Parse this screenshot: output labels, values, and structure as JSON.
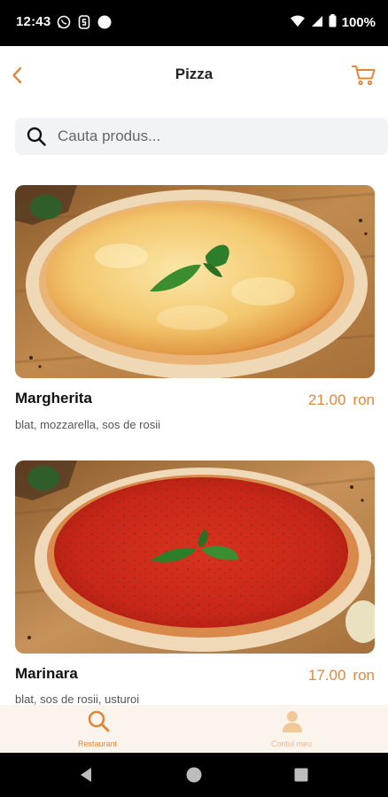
{
  "status_bar": {
    "time": "12:43",
    "battery": "100%",
    "icons": [
      "whatsapp-icon",
      "s-app-icon",
      "circle-dot-icon",
      "wifi-icon",
      "signal-icon",
      "battery-icon"
    ]
  },
  "header": {
    "title": "Pizza",
    "back_icon": "chevron-left-icon",
    "cart_icon": "cart-icon"
  },
  "search": {
    "placeholder": "Cauta produs...",
    "value": ""
  },
  "products": [
    {
      "name": "Margherita",
      "price": "21.00",
      "currency": "ron",
      "description": "blat, mozzarella, sos de rosii"
    },
    {
      "name": "Marinara",
      "price": "17.00",
      "currency": "ron",
      "description": "blat, sos de rosii, usturoi"
    }
  ],
  "bottom_nav": {
    "items": [
      {
        "label": "Restaurant",
        "icon": "search-icon",
        "active": true
      },
      {
        "label": "Contul meu",
        "icon": "user-icon",
        "active": false
      }
    ]
  },
  "colors": {
    "accent": "#e0883a",
    "nav_background": "#fbf4ec",
    "search_background": "#f2f3f5"
  }
}
